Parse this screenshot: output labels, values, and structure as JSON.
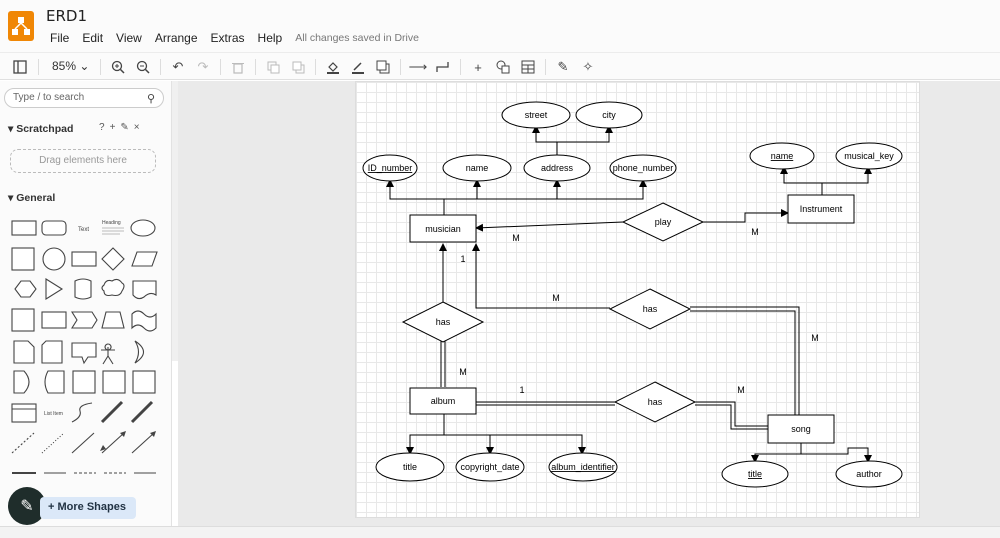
{
  "app": {
    "title": "ERD1",
    "save_status": "All changes saved in Drive"
  },
  "menu": [
    "File",
    "Edit",
    "View",
    "Arrange",
    "Extras",
    "Help"
  ],
  "toolbar": {
    "zoom": "85%"
  },
  "sidebar": {
    "search_placeholder": "Type / to search",
    "scratchpad_title": "Scratchpad",
    "drop_hint": "Drag elements here",
    "general_title": "General",
    "shape_text_label": "Text",
    "shape_heading_label": "Heading",
    "shape_list_label": "List Item",
    "more_shapes": "+ More Shapes"
  },
  "diagram": {
    "entities": {
      "musician": "musician",
      "instrument": "Instrument",
      "album": "album",
      "song": "song"
    },
    "relationships": {
      "play": "play",
      "has_musician_song": "has",
      "has_musician_album": "has",
      "has_album_song": "has"
    },
    "attributes": {
      "street": "street",
      "city": "city",
      "id_number": "ID_number",
      "musician_name": "name",
      "address": "address",
      "phone_number": "phone_number",
      "instrument_name": "name",
      "musical_key": "musical_key",
      "album_title": "title",
      "copyright_date": "copyright_date",
      "album_identifier": "album_identifier",
      "song_title": "title",
      "author": "author"
    },
    "cardinalities": {
      "musician_play": "M",
      "play_instrument": "M",
      "musician_album_side": "1",
      "album_musician_side": "M",
      "musician_song_side": "M",
      "song_musician_side": "M",
      "album_song_side": "1",
      "song_album_side": "M"
    }
  },
  "colors": {
    "accent": "#f08705",
    "fab": "#1f2d2b",
    "more_shapes_bg": "#dbe8f8"
  }
}
